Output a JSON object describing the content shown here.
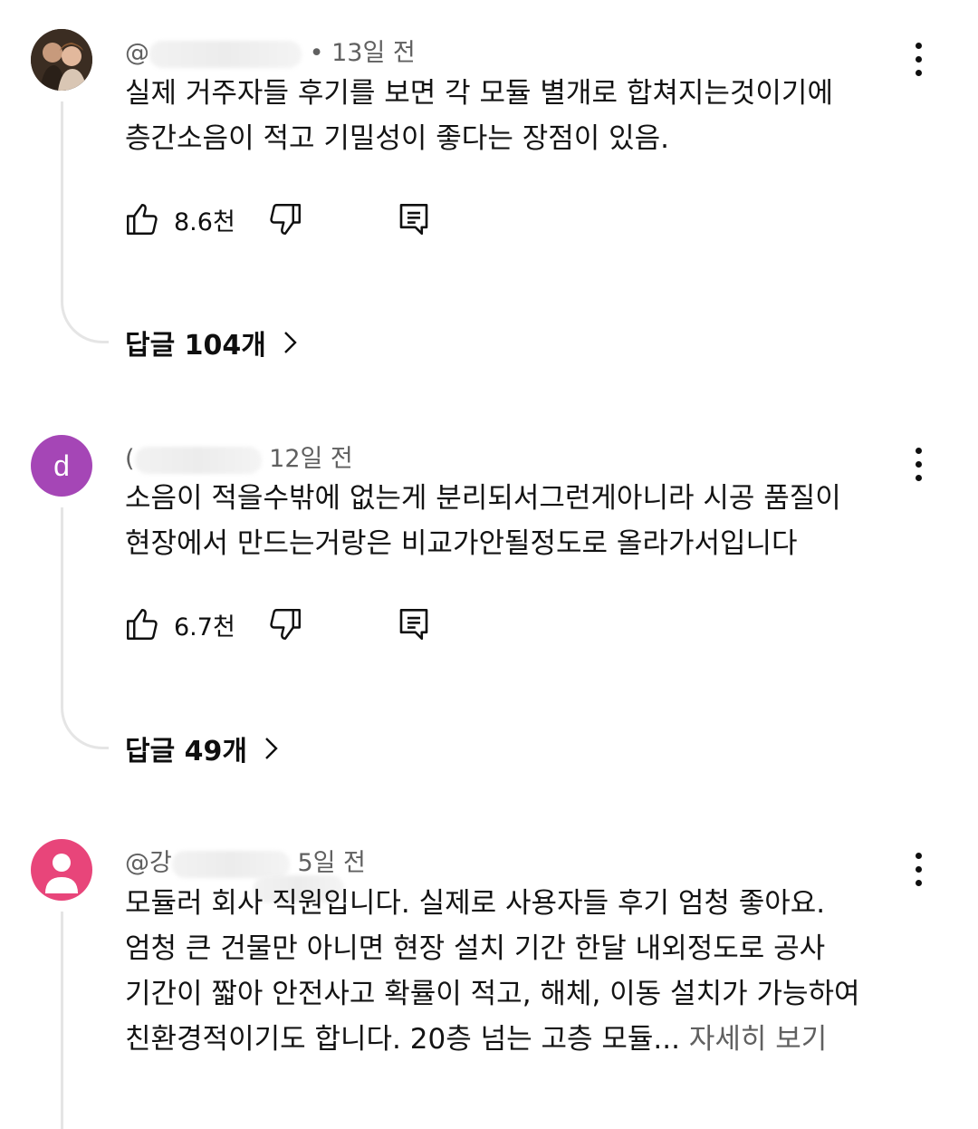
{
  "comments": [
    {
      "handle_prefix": "@",
      "time": "• 13일 전",
      "lines": [
        "실제 거주자들 후기를 보면 각 모듈 별개로 합쳐지는것이기에",
        "층간소음이 적고 기밀성이 좋다는 장점이 있음."
      ],
      "likes": "8.6천",
      "replies": "답글 104개"
    },
    {
      "handle_prefix": "(",
      "avatar_letter": "d",
      "time": "12일 전",
      "lines": [
        "소음이 적을수밖에 없는게 분리되서그런게아니라 시공 품질이",
        "현장에서 만드는거랑은 비교가안될정도로 올라가서입니다"
      ],
      "likes": "6.7천",
      "replies": "답글 49개"
    },
    {
      "handle_prefix": "@강",
      "time": "5일 전",
      "lines": [
        "모듈러 회사 직원입니다. 실제로 사용자들 후기 엄청 좋아요.",
        "엄청 큰 건물만 아니면 현장 설치 기간 한달 내외정도로 공사",
        "기간이 짧아 안전사고 확률이 적고, 해체, 이동 설치가 가능하여"
      ],
      "last_line": "친환경적이기도 합니다. 20층 넘는 고층 모듈...",
      "more": " 자세히 보기"
    }
  ],
  "colors": {
    "avatar_d": "#a546b6",
    "avatar_default": "#e8457a",
    "meta": "#606060",
    "thread": "#e5e5e5"
  },
  "icons": [
    "like-icon",
    "dislike-icon",
    "reply-icon",
    "more-vert-icon",
    "chevron-right-icon"
  ]
}
